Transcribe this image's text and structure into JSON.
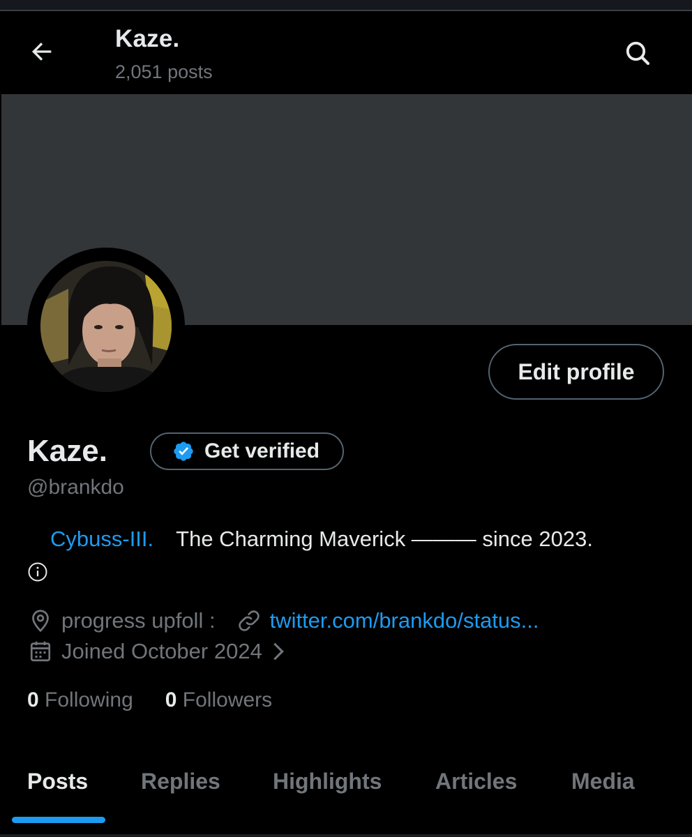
{
  "header": {
    "title": "Kaze.",
    "posts_count": "2,051 posts"
  },
  "profile": {
    "display_name": "Kaze.",
    "handle": "@brankdo",
    "edit_label": "Edit profile",
    "verify_label": "Get verified",
    "bio": {
      "mention": "Cybuss-III.",
      "text": "The Charming Maverick ——— since 2023."
    },
    "location": "progress upfoll :",
    "website": "twitter.com/brankdo/status...",
    "joined": "Joined October 2024",
    "following_count": "0",
    "following_label": "Following",
    "followers_count": "0",
    "followers_label": "Followers"
  },
  "tabs": [
    {
      "label": "Posts",
      "active": true
    },
    {
      "label": "Replies",
      "active": false
    },
    {
      "label": "Highlights",
      "active": false
    },
    {
      "label": "Articles",
      "active": false
    },
    {
      "label": "Media",
      "active": false
    }
  ],
  "colors": {
    "background": "#000000",
    "banner": "#333639",
    "accent": "#1d9bf0",
    "primary_text": "#e7e9ea",
    "secondary_text": "#71767b",
    "border": "#536471"
  },
  "icons": [
    "arrow-left-icon",
    "search-icon",
    "verified-badge-icon",
    "info-icon",
    "location-pin-icon",
    "link-icon",
    "calendar-icon",
    "chevron-right-icon"
  ]
}
